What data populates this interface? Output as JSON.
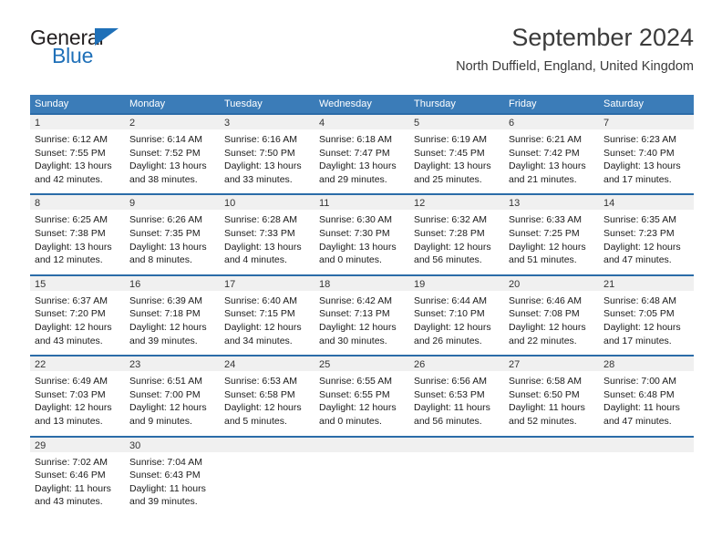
{
  "logo": {
    "word1": "General",
    "word2": "Blue",
    "triangle_color": "#1f70b8"
  },
  "header": {
    "title": "September 2024",
    "subtitle": "North Duffield, England, United Kingdom"
  },
  "colors": {
    "header_blue": "#3b7cb8",
    "row_border_blue": "#2b6ca8",
    "day_number_bg": "#f0f0f0"
  },
  "weekdays": [
    "Sunday",
    "Monday",
    "Tuesday",
    "Wednesday",
    "Thursday",
    "Friday",
    "Saturday"
  ],
  "labels": {
    "sunrise_prefix": "Sunrise:",
    "sunset_prefix": "Sunset:",
    "daylight_prefix": "Daylight:"
  },
  "weeks": [
    [
      {
        "day": "1",
        "sunrise": "Sunrise: 6:12 AM",
        "sunset": "Sunset: 7:55 PM",
        "daylight_line1": "Daylight: 13 hours",
        "daylight_line2": "and 42 minutes."
      },
      {
        "day": "2",
        "sunrise": "Sunrise: 6:14 AM",
        "sunset": "Sunset: 7:52 PM",
        "daylight_line1": "Daylight: 13 hours",
        "daylight_line2": "and 38 minutes."
      },
      {
        "day": "3",
        "sunrise": "Sunrise: 6:16 AM",
        "sunset": "Sunset: 7:50 PM",
        "daylight_line1": "Daylight: 13 hours",
        "daylight_line2": "and 33 minutes."
      },
      {
        "day": "4",
        "sunrise": "Sunrise: 6:18 AM",
        "sunset": "Sunset: 7:47 PM",
        "daylight_line1": "Daylight: 13 hours",
        "daylight_line2": "and 29 minutes."
      },
      {
        "day": "5",
        "sunrise": "Sunrise: 6:19 AM",
        "sunset": "Sunset: 7:45 PM",
        "daylight_line1": "Daylight: 13 hours",
        "daylight_line2": "and 25 minutes."
      },
      {
        "day": "6",
        "sunrise": "Sunrise: 6:21 AM",
        "sunset": "Sunset: 7:42 PM",
        "daylight_line1": "Daylight: 13 hours",
        "daylight_line2": "and 21 minutes."
      },
      {
        "day": "7",
        "sunrise": "Sunrise: 6:23 AM",
        "sunset": "Sunset: 7:40 PM",
        "daylight_line1": "Daylight: 13 hours",
        "daylight_line2": "and 17 minutes."
      }
    ],
    [
      {
        "day": "8",
        "sunrise": "Sunrise: 6:25 AM",
        "sunset": "Sunset: 7:38 PM",
        "daylight_line1": "Daylight: 13 hours",
        "daylight_line2": "and 12 minutes."
      },
      {
        "day": "9",
        "sunrise": "Sunrise: 6:26 AM",
        "sunset": "Sunset: 7:35 PM",
        "daylight_line1": "Daylight: 13 hours",
        "daylight_line2": "and 8 minutes."
      },
      {
        "day": "10",
        "sunrise": "Sunrise: 6:28 AM",
        "sunset": "Sunset: 7:33 PM",
        "daylight_line1": "Daylight: 13 hours",
        "daylight_line2": "and 4 minutes."
      },
      {
        "day": "11",
        "sunrise": "Sunrise: 6:30 AM",
        "sunset": "Sunset: 7:30 PM",
        "daylight_line1": "Daylight: 13 hours",
        "daylight_line2": "and 0 minutes."
      },
      {
        "day": "12",
        "sunrise": "Sunrise: 6:32 AM",
        "sunset": "Sunset: 7:28 PM",
        "daylight_line1": "Daylight: 12 hours",
        "daylight_line2": "and 56 minutes."
      },
      {
        "day": "13",
        "sunrise": "Sunrise: 6:33 AM",
        "sunset": "Sunset: 7:25 PM",
        "daylight_line1": "Daylight: 12 hours",
        "daylight_line2": "and 51 minutes."
      },
      {
        "day": "14",
        "sunrise": "Sunrise: 6:35 AM",
        "sunset": "Sunset: 7:23 PM",
        "daylight_line1": "Daylight: 12 hours",
        "daylight_line2": "and 47 minutes."
      }
    ],
    [
      {
        "day": "15",
        "sunrise": "Sunrise: 6:37 AM",
        "sunset": "Sunset: 7:20 PM",
        "daylight_line1": "Daylight: 12 hours",
        "daylight_line2": "and 43 minutes."
      },
      {
        "day": "16",
        "sunrise": "Sunrise: 6:39 AM",
        "sunset": "Sunset: 7:18 PM",
        "daylight_line1": "Daylight: 12 hours",
        "daylight_line2": "and 39 minutes."
      },
      {
        "day": "17",
        "sunrise": "Sunrise: 6:40 AM",
        "sunset": "Sunset: 7:15 PM",
        "daylight_line1": "Daylight: 12 hours",
        "daylight_line2": "and 34 minutes."
      },
      {
        "day": "18",
        "sunrise": "Sunrise: 6:42 AM",
        "sunset": "Sunset: 7:13 PM",
        "daylight_line1": "Daylight: 12 hours",
        "daylight_line2": "and 30 minutes."
      },
      {
        "day": "19",
        "sunrise": "Sunrise: 6:44 AM",
        "sunset": "Sunset: 7:10 PM",
        "daylight_line1": "Daylight: 12 hours",
        "daylight_line2": "and 26 minutes."
      },
      {
        "day": "20",
        "sunrise": "Sunrise: 6:46 AM",
        "sunset": "Sunset: 7:08 PM",
        "daylight_line1": "Daylight: 12 hours",
        "daylight_line2": "and 22 minutes."
      },
      {
        "day": "21",
        "sunrise": "Sunrise: 6:48 AM",
        "sunset": "Sunset: 7:05 PM",
        "daylight_line1": "Daylight: 12 hours",
        "daylight_line2": "and 17 minutes."
      }
    ],
    [
      {
        "day": "22",
        "sunrise": "Sunrise: 6:49 AM",
        "sunset": "Sunset: 7:03 PM",
        "daylight_line1": "Daylight: 12 hours",
        "daylight_line2": "and 13 minutes."
      },
      {
        "day": "23",
        "sunrise": "Sunrise: 6:51 AM",
        "sunset": "Sunset: 7:00 PM",
        "daylight_line1": "Daylight: 12 hours",
        "daylight_line2": "and 9 minutes."
      },
      {
        "day": "24",
        "sunrise": "Sunrise: 6:53 AM",
        "sunset": "Sunset: 6:58 PM",
        "daylight_line1": "Daylight: 12 hours",
        "daylight_line2": "and 5 minutes."
      },
      {
        "day": "25",
        "sunrise": "Sunrise: 6:55 AM",
        "sunset": "Sunset: 6:55 PM",
        "daylight_line1": "Daylight: 12 hours",
        "daylight_line2": "and 0 minutes."
      },
      {
        "day": "26",
        "sunrise": "Sunrise: 6:56 AM",
        "sunset": "Sunset: 6:53 PM",
        "daylight_line1": "Daylight: 11 hours",
        "daylight_line2": "and 56 minutes."
      },
      {
        "day": "27",
        "sunrise": "Sunrise: 6:58 AM",
        "sunset": "Sunset: 6:50 PM",
        "daylight_line1": "Daylight: 11 hours",
        "daylight_line2": "and 52 minutes."
      },
      {
        "day": "28",
        "sunrise": "Sunrise: 7:00 AM",
        "sunset": "Sunset: 6:48 PM",
        "daylight_line1": "Daylight: 11 hours",
        "daylight_line2": "and 47 minutes."
      }
    ],
    [
      {
        "day": "29",
        "sunrise": "Sunrise: 7:02 AM",
        "sunset": "Sunset: 6:46 PM",
        "daylight_line1": "Daylight: 11 hours",
        "daylight_line2": "and 43 minutes."
      },
      {
        "day": "30",
        "sunrise": "Sunrise: 7:04 AM",
        "sunset": "Sunset: 6:43 PM",
        "daylight_line1": "Daylight: 11 hours",
        "daylight_line2": "and 39 minutes."
      },
      {
        "day": "",
        "sunrise": "",
        "sunset": "",
        "daylight_line1": "",
        "daylight_line2": ""
      },
      {
        "day": "",
        "sunrise": "",
        "sunset": "",
        "daylight_line1": "",
        "daylight_line2": ""
      },
      {
        "day": "",
        "sunrise": "",
        "sunset": "",
        "daylight_line1": "",
        "daylight_line2": ""
      },
      {
        "day": "",
        "sunrise": "",
        "sunset": "",
        "daylight_line1": "",
        "daylight_line2": ""
      },
      {
        "day": "",
        "sunrise": "",
        "sunset": "",
        "daylight_line1": "",
        "daylight_line2": ""
      }
    ]
  ]
}
